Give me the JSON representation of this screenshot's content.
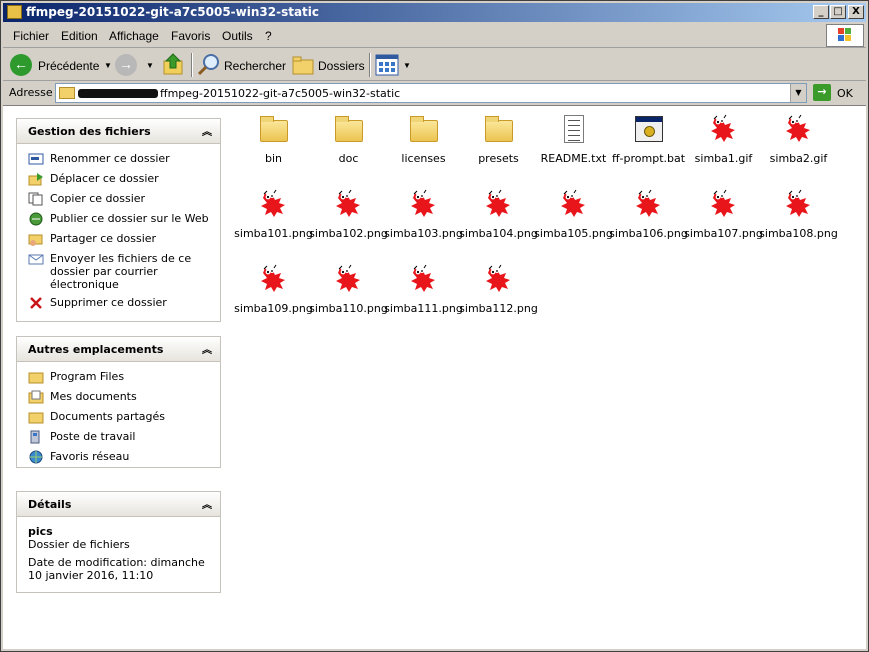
{
  "window": {
    "title": "ffmpeg-20151022-git-a7c5005-win32-static",
    "min": "_",
    "max": "□",
    "close": "X"
  },
  "menu": [
    "Fichier",
    "Edition",
    "Affichage",
    "Favoris",
    "Outils",
    "?"
  ],
  "toolbar": {
    "back": "Précédente",
    "search": "Rechercher",
    "folders": "Dossiers"
  },
  "address": {
    "label": "Adresse",
    "path": "ffmpeg-20151022-git-a7c5005-win32-static",
    "go": "OK"
  },
  "panels": {
    "file_tasks": {
      "title": "Gestion des fichiers",
      "items": [
        "Renommer ce dossier",
        "Déplacer ce dossier",
        "Copier ce dossier",
        "Publier ce dossier sur le Web",
        "Partager ce dossier",
        "Envoyer les fichiers de ce dossier par courrier électronique",
        "Supprimer ce dossier"
      ]
    },
    "other_places": {
      "title": "Autres emplacements",
      "items": [
        "Program Files",
        "Mes documents",
        "Documents partagés",
        "Poste de travail",
        "Favoris réseau"
      ]
    },
    "details": {
      "title": "Détails",
      "name": "pics",
      "type": "Dossier de fichiers",
      "modified": "Date de modification: dimanche 10 janvier 2016, 11:10"
    }
  },
  "files": [
    {
      "name": "bin",
      "icon": "folder-icon"
    },
    {
      "name": "doc",
      "icon": "folder-icon"
    },
    {
      "name": "licenses",
      "icon": "folder-icon"
    },
    {
      "name": "presets",
      "icon": "folder-icon"
    },
    {
      "name": "README.txt",
      "icon": "text-file-icon"
    },
    {
      "name": "ff-prompt.bat",
      "icon": "batch-file-icon"
    },
    {
      "name": "simba1.gif",
      "icon": "image-file-icon"
    },
    {
      "name": "simba2.gif",
      "icon": "image-file-icon"
    },
    {
      "name": "simba101.png",
      "icon": "image-file-icon"
    },
    {
      "name": "simba102.png",
      "icon": "image-file-icon"
    },
    {
      "name": "simba103.png",
      "icon": "image-file-icon"
    },
    {
      "name": "simba104.png",
      "icon": "image-file-icon"
    },
    {
      "name": "simba105.png",
      "icon": "image-file-icon"
    },
    {
      "name": "simba106.png",
      "icon": "image-file-icon"
    },
    {
      "name": "simba107.png",
      "icon": "image-file-icon"
    },
    {
      "name": "simba108.png",
      "icon": "image-file-icon"
    },
    {
      "name": "simba109.png",
      "icon": "image-file-icon"
    },
    {
      "name": "simba110.png",
      "icon": "image-file-icon"
    },
    {
      "name": "simba111.png",
      "icon": "image-file-icon"
    },
    {
      "name": "simba112.png",
      "icon": "image-file-icon"
    }
  ],
  "colors": {
    "title_start": "#0a246a",
    "title_end": "#a6caf0",
    "simba_red": "#e8161b"
  }
}
